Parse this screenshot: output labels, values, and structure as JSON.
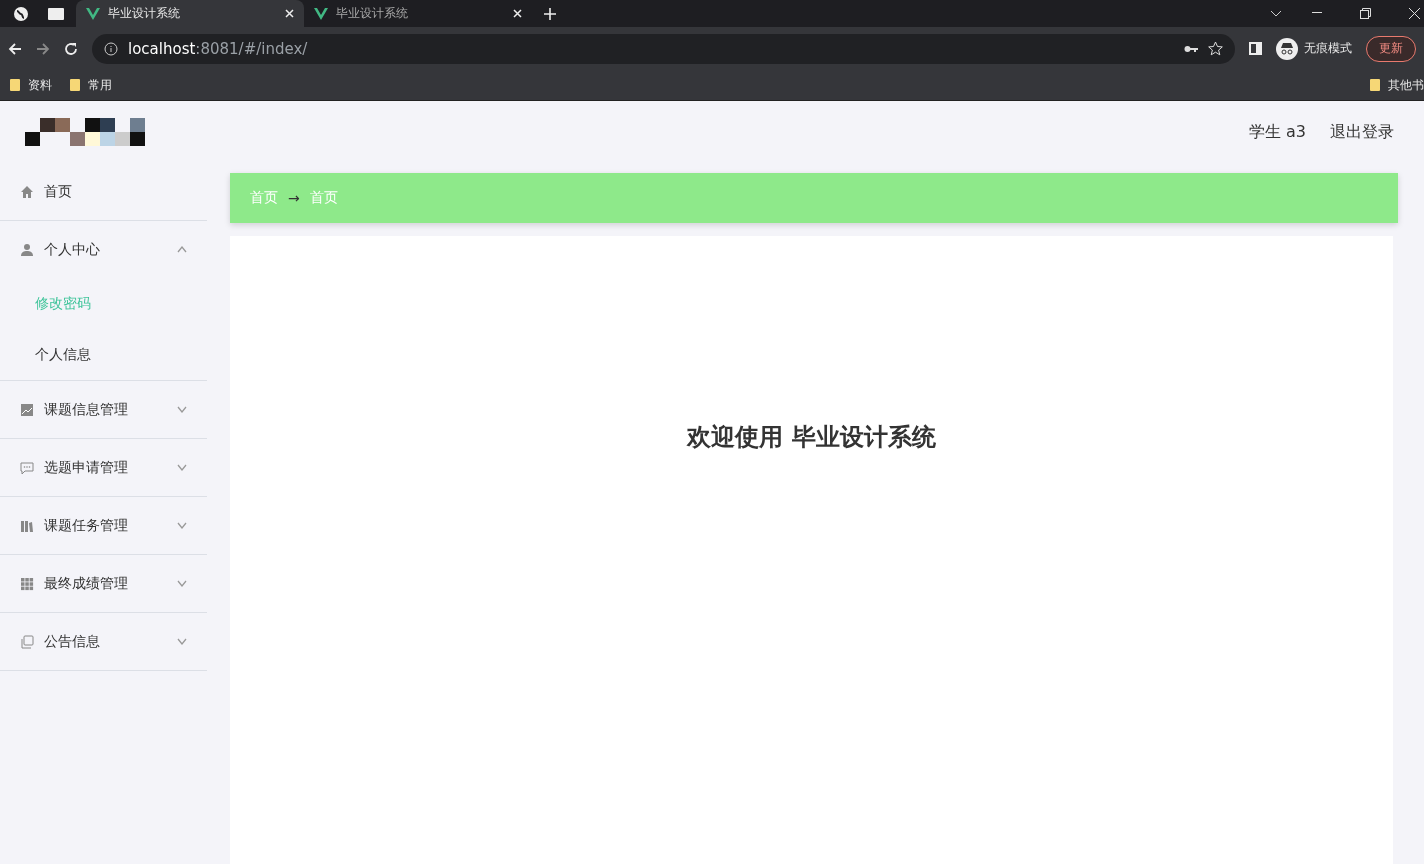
{
  "browser": {
    "tabs": [
      {
        "title": "毕业设计系统",
        "selected": true
      },
      {
        "title": "毕业设计系统",
        "selected": false
      }
    ],
    "address": {
      "host": "localhost",
      "path": ":8081/#/index/"
    },
    "profile": "无痕模式",
    "update_button": "更新",
    "bookmarks": [
      "资料",
      "常用"
    ],
    "other_bookmarks": "其他书"
  },
  "header": {
    "user": "学生 a3",
    "logout": "退出登录"
  },
  "sidebar": {
    "items": [
      {
        "label": "首页"
      },
      {
        "label": "个人中心",
        "expanded": true,
        "children": [
          {
            "label": "修改密码",
            "selected": true
          },
          {
            "label": "个人信息",
            "selected": false
          }
        ]
      },
      {
        "label": "课题信息管理",
        "expanded": false
      },
      {
        "label": "选题申请管理",
        "expanded": false
      },
      {
        "label": "课题任务管理",
        "expanded": false
      },
      {
        "label": "最终成绩管理",
        "expanded": false
      },
      {
        "label": "公告信息",
        "expanded": false
      }
    ]
  },
  "breadcrumb": {
    "items": [
      "首页",
      "首页"
    ],
    "separator": "→"
  },
  "welcome": "欢迎使用 毕业设计系统"
}
